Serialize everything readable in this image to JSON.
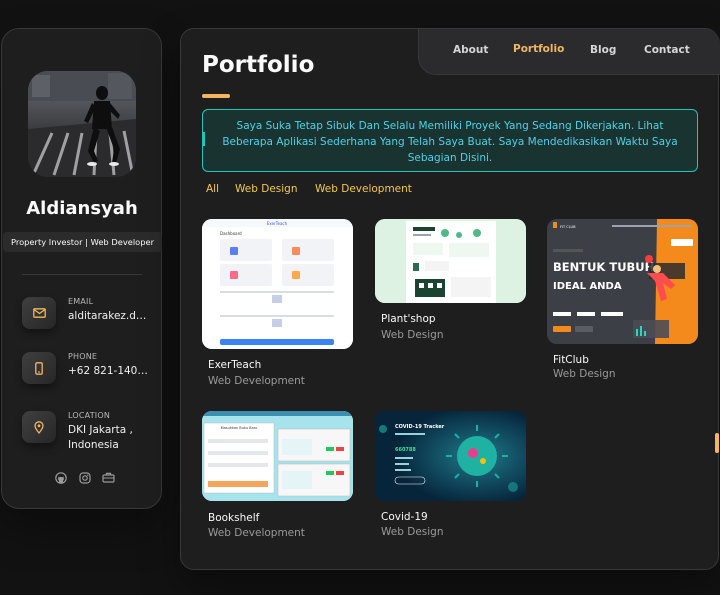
{
  "profile": {
    "name": "Aldiansyah",
    "role": "Property Investor | Web Developer"
  },
  "contacts": [
    {
      "label": "EMAIL",
      "value": "alditarakez.de...",
      "icon": "mail-icon"
    },
    {
      "label": "PHONE",
      "value": "+62 821-1402-...",
      "icon": "phone-icon"
    },
    {
      "label": "LOCATION",
      "value": "DKI Jakarta , Indonesia",
      "icon": "location-pin-icon"
    }
  ],
  "socials": [
    "github-icon",
    "instagram-icon",
    "briefcase-icon"
  ],
  "nav": {
    "about": "About",
    "portfolio": "Portfolio",
    "blog": "Blog",
    "contact": "Contact"
  },
  "page": {
    "title": "Portfolio",
    "intro": "Saya Suka Tetap Sibuk Dan Selalu Memiliki Proyek Yang Sedang Dikerjakan. Lihat Beberapa Aplikasi Sederhana Yang Telah Saya Buat. Saya Mendedikasikan Waktu Saya Sebagian Disini."
  },
  "filters": [
    "All",
    "Web Design",
    "Web Development"
  ],
  "projects": [
    {
      "title": "ExerTeach",
      "category": "Web Development"
    },
    {
      "title": "Plant'shop",
      "category": "Web Design"
    },
    {
      "title": "FitClub",
      "category": "Web Design"
    },
    {
      "title": "Bookshelf",
      "category": "Web Development"
    },
    {
      "title": "Covid-19",
      "category": "Web Design"
    }
  ],
  "thumb_text": {
    "exerteach_header": "ExerTeach",
    "exerteach_section": "Dashboard",
    "bookshelf_header": "Masukkan Buku Baru",
    "covid_title": "COVID-19 Tracker",
    "covid_number": "660788",
    "fitclub_logo": "FIT CLUB",
    "fitclub_headline_1": "BENTUK TUBUH",
    "fitclub_headline_2": "IDEAL ANDA"
  },
  "colors": {
    "accent": "#f2b661",
    "teal": "#1ec8b7",
    "panel": "#1e1e1f",
    "bg": "#121212"
  }
}
